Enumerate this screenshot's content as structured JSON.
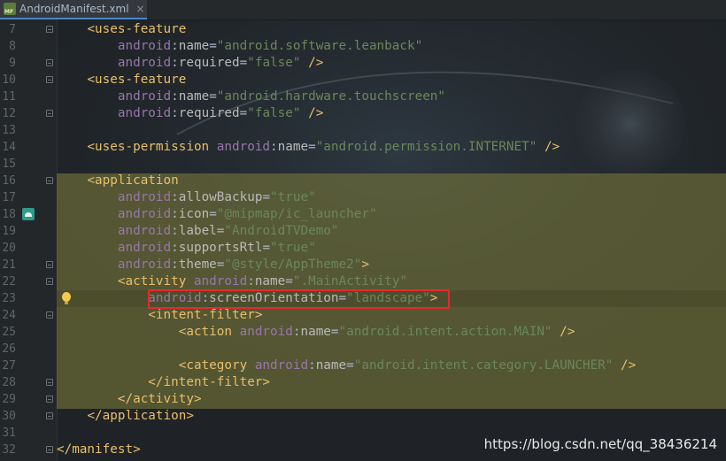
{
  "tab": {
    "label": "AndroidManifest.xml",
    "icon": "MF",
    "close": "×"
  },
  "lines": [
    {
      "n": "7",
      "text": "    <uses-feature"
    },
    {
      "n": "8",
      "text": "        android:name=\"android.software.leanback\""
    },
    {
      "n": "9",
      "text": "        android:required=\"false\" />"
    },
    {
      "n": "10",
      "text": "    <uses-feature"
    },
    {
      "n": "11",
      "text": "        android:name=\"android.hardware.touchscreen\""
    },
    {
      "n": "12",
      "text": "        android:required=\"false\" />"
    },
    {
      "n": "13",
      "text": ""
    },
    {
      "n": "14",
      "text": "    <uses-permission android:name=\"android.permission.INTERNET\" />"
    },
    {
      "n": "15",
      "text": ""
    },
    {
      "n": "16",
      "text": "    <application"
    },
    {
      "n": "17",
      "text": "        android:allowBackup=\"true\""
    },
    {
      "n": "18",
      "text": "        android:icon=\"@mipmap/ic_launcher\""
    },
    {
      "n": "19",
      "text": "        android:label=\"AndroidTVDemo\""
    },
    {
      "n": "20",
      "text": "        android:supportsRtl=\"true\""
    },
    {
      "n": "21",
      "text": "        android:theme=\"@style/AppTheme2\">"
    },
    {
      "n": "22",
      "text": "        <activity android:name=\".MainActivity\""
    },
    {
      "n": "23",
      "text": "            android:screenOrientation=\"landscape\">"
    },
    {
      "n": "24",
      "text": "            <intent-filter>"
    },
    {
      "n": "25",
      "text": "                <action android:name=\"android.intent.action.MAIN\" />"
    },
    {
      "n": "26",
      "text": ""
    },
    {
      "n": "27",
      "text": "                <category android:name=\"android.intent.category.LAUNCHER\" />"
    },
    {
      "n": "28",
      "text": "            </intent-filter>"
    },
    {
      "n": "29",
      "text": "        </activity>"
    },
    {
      "n": "30",
      "text": "    </application>"
    },
    {
      "n": "31",
      "text": ""
    },
    {
      "n": "32",
      "text": "</manifest>"
    }
  ],
  "watermark": "https://blog.csdn.net/qq_38436214",
  "colors": {
    "tag": "#e8bf6a",
    "namespace": "#9876aa",
    "attribute": "#bababa",
    "value": "#6a8759",
    "highlight": "#76763a",
    "annotation_box": "#e8292a"
  }
}
